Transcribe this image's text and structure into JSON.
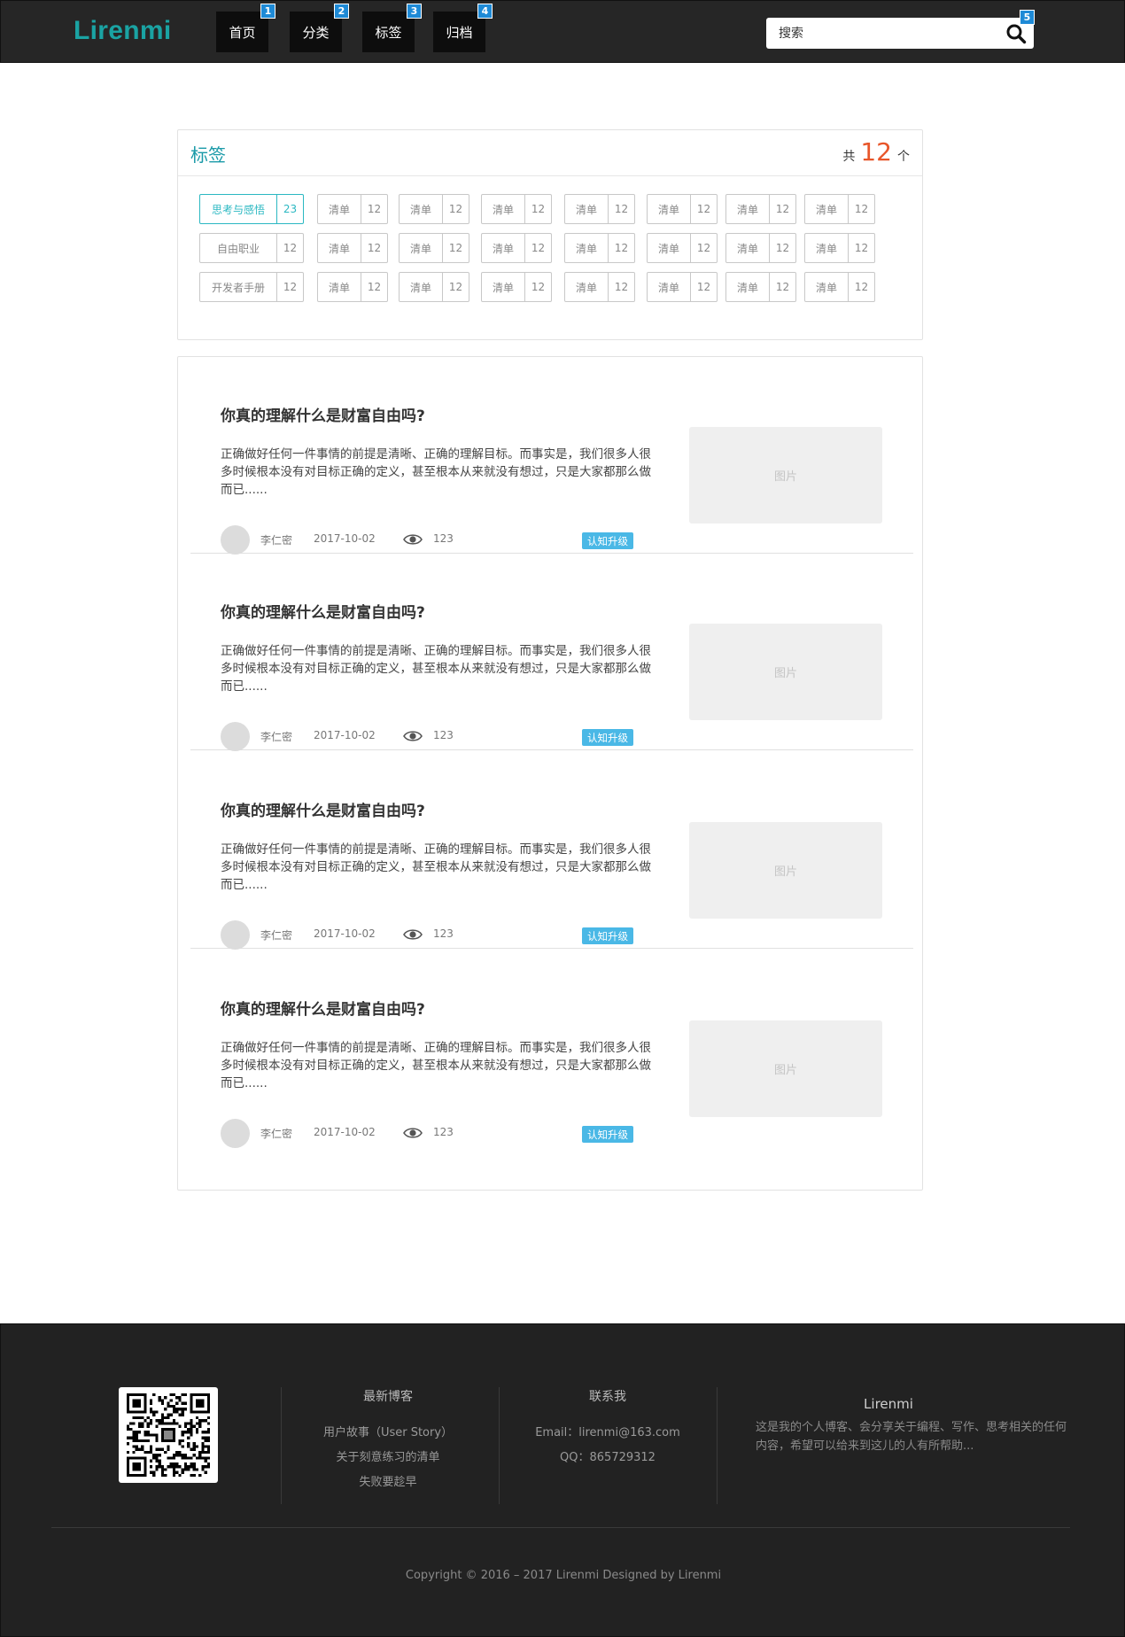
{
  "header": {
    "logo": "Lirenmi",
    "nav": [
      {
        "label": "首页",
        "badge": "1"
      },
      {
        "label": "分类",
        "badge": "2"
      },
      {
        "label": "标签",
        "badge": "3"
      },
      {
        "label": "归档",
        "badge": "4"
      }
    ],
    "search": {
      "placeholder": "搜索",
      "badge": "5"
    }
  },
  "tags": {
    "title": "标签",
    "total_prefix": "共",
    "total": "12",
    "total_suffix": "个",
    "rows": [
      [
        {
          "name": "思考与感悟",
          "count": "23",
          "active": true
        },
        {
          "name": "清单",
          "count": "12"
        },
        {
          "name": "清单",
          "count": "12"
        },
        {
          "name": "清单",
          "count": "12"
        },
        {
          "name": "清单",
          "count": "12"
        },
        {
          "name": "清单",
          "count": "12"
        },
        {
          "name": "清单",
          "count": "12"
        },
        {
          "name": "清单",
          "count": "12"
        }
      ],
      [
        {
          "name": "自由职业",
          "count": "12"
        },
        {
          "name": "清单",
          "count": "12"
        },
        {
          "name": "清单",
          "count": "12"
        },
        {
          "name": "清单",
          "count": "12"
        },
        {
          "name": "清单",
          "count": "12"
        },
        {
          "name": "清单",
          "count": "12"
        },
        {
          "name": "清单",
          "count": "12"
        },
        {
          "name": "清单",
          "count": "12"
        }
      ],
      [
        {
          "name": "开发者手册",
          "count": "12"
        },
        {
          "name": "清单",
          "count": "12"
        },
        {
          "name": "清单",
          "count": "12"
        },
        {
          "name": "清单",
          "count": "12"
        },
        {
          "name": "清单",
          "count": "12"
        },
        {
          "name": "清单",
          "count": "12"
        },
        {
          "name": "清单",
          "count": "12"
        },
        {
          "name": "清单",
          "count": "12"
        }
      ]
    ]
  },
  "articles": [
    {
      "title": "你真的理解什么是财富自由吗?",
      "excerpt": "正确做好任何一件事情的前提是清晰、正确的理解目标。而事实是，我们很多人很多时候根本没有对目标正确的定义，甚至根本从来就没有想过，只是大家都那么做而已......",
      "author": "李仁密",
      "date": "2017-10-02",
      "views": "123",
      "tag": "认知升级",
      "image": "图片"
    },
    {
      "title": "你真的理解什么是财富自由吗?",
      "excerpt": "正确做好任何一件事情的前提是清晰、正确的理解目标。而事实是，我们很多人很多时候根本没有对目标正确的定义，甚至根本从来就没有想过，只是大家都那么做而已......",
      "author": "李仁密",
      "date": "2017-10-02",
      "views": "123",
      "tag": "认知升级",
      "image": "图片"
    },
    {
      "title": "你真的理解什么是财富自由吗?",
      "excerpt": "正确做好任何一件事情的前提是清晰、正确的理解目标。而事实是，我们很多人很多时候根本没有对目标正确的定义，甚至根本从来就没有想过，只是大家都那么做而已......",
      "author": "李仁密",
      "date": "2017-10-02",
      "views": "123",
      "tag": "认知升级",
      "image": "图片"
    },
    {
      "title": "你真的理解什么是财富自由吗?",
      "excerpt": "正确做好任何一件事情的前提是清晰、正确的理解目标。而事实是，我们很多人很多时候根本没有对目标正确的定义，甚至根本从来就没有想过，只是大家都那么做而已......",
      "author": "李仁密",
      "date": "2017-10-02",
      "views": "123",
      "tag": "认知升级",
      "image": "图片"
    }
  ],
  "footer": {
    "latest": {
      "title": "最新博客",
      "links": [
        "用户故事（User Story）",
        "关于刻意练习的清单",
        "失败要趁早"
      ]
    },
    "contact": {
      "title": "联系我",
      "email": "Email：lirenmi@163.com",
      "qq": "QQ：865729312"
    },
    "about": {
      "title": "Lirenmi",
      "text": "这是我的个人博客、会分享关于编程、写作、思考相关的任何内容，希望可以给来到这儿的人有所帮助..."
    },
    "copyright": "Copyright © 2016 – 2017 Lirenmi Designed by Lirenmi"
  },
  "colors": {
    "accent": "#1aa3a3",
    "count_highlight": "#e8562a",
    "tag_badge": "#4ab8e6",
    "header_bg": "#262626",
    "footer_bg": "#222222"
  }
}
